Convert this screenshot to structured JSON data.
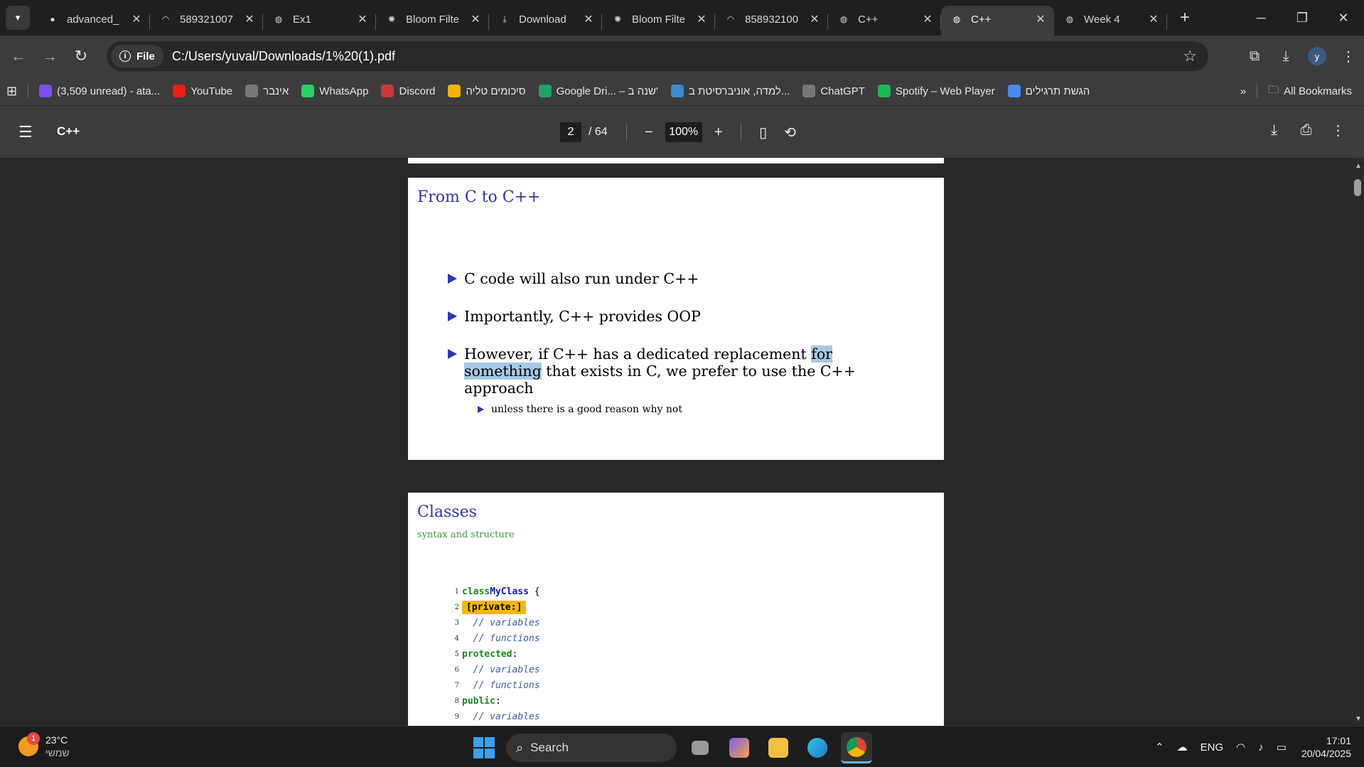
{
  "browser": {
    "tabs": [
      {
        "label": "advanced_",
        "icon": "github-icon",
        "active": false
      },
      {
        "label": "589321007",
        "icon": "moodle-icon",
        "active": false
      },
      {
        "label": "Ex1",
        "icon": "globe-icon",
        "active": false
      },
      {
        "label": "Bloom Filte",
        "icon": "chatgpt-icon",
        "active": false
      },
      {
        "label": "Download",
        "icon": "download-icon",
        "active": false
      },
      {
        "label": "Bloom Filte",
        "icon": "chatgpt-icon",
        "active": false
      },
      {
        "label": "858932100",
        "icon": "moodle-icon",
        "active": false
      },
      {
        "label": "C++",
        "icon": "globe-icon",
        "active": false
      },
      {
        "label": "C++",
        "icon": "globe-icon",
        "active": true
      },
      {
        "label": "Week 4",
        "icon": "globe-icon",
        "active": false
      }
    ],
    "address": {
      "chip_label": "File",
      "url": "C:/Users/yuval/Downloads/1%20(1).pdf"
    },
    "profile_initial": "y",
    "bookmarks": [
      {
        "label": "(3,509 unread) - ata...",
        "icon": "mail-icon",
        "color": "#7b4ff0"
      },
      {
        "label": "YouTube",
        "icon": "youtube-icon",
        "color": "#e62117"
      },
      {
        "label": "אינבר",
        "icon": "globe-icon",
        "color": "#777777"
      },
      {
        "label": "WhatsApp",
        "icon": "whatsapp-icon",
        "color": "#25d366"
      },
      {
        "label": "Discord",
        "icon": "discord-icon",
        "color": "#c93a3a"
      },
      {
        "label": "סיכומים טליה",
        "icon": "drive-icon",
        "color": "#f4b400"
      },
      {
        "label": "Google Dri... – שנה ב'",
        "icon": "drive-icon",
        "color": "#1fa463"
      },
      {
        "label": "למדה, אוניברסיטת ב...",
        "icon": "moodle-icon",
        "color": "#3b8bd0"
      },
      {
        "label": "ChatGPT",
        "icon": "chatgpt-icon",
        "color": "#777777"
      },
      {
        "label": "Spotify – Web Player",
        "icon": "spotify-icon",
        "color": "#1db954"
      },
      {
        "label": "הגשת תרגילים",
        "icon": "upload-icon",
        "color": "#4a8af4"
      }
    ],
    "all_bookmarks_label": "All Bookmarks"
  },
  "pdf": {
    "title": "C++",
    "current_page": "2",
    "total_pages": "/ 64",
    "zoom": "100%"
  },
  "slides": {
    "slide1": {
      "title": "From C to C++",
      "bullets": [
        {
          "text": "C code will also run under C++"
        },
        {
          "text": "Importantly, C++ provides OOP"
        },
        {
          "pre": "However, if C++ has a dedicated replacement ",
          "highlight": "for something",
          "post": " that exists in C, we prefer to use the C++ approach"
        }
      ],
      "subbullet": "unless there is a good reason why not"
    },
    "slide2": {
      "title": "Classes",
      "subtitle": "syntax and structure",
      "code": [
        {
          "n": "1",
          "kw": "class",
          "cls": "MyClass",
          "rest": " {"
        },
        {
          "n": "2",
          "priv": "[private:]"
        },
        {
          "n": "3",
          "cmt": "  // variables"
        },
        {
          "n": "4",
          "cmt": "  // functions"
        },
        {
          "n": "5",
          "kw": "protected",
          "rest": ":"
        },
        {
          "n": "6",
          "cmt": "  // variables"
        },
        {
          "n": "7",
          "cmt": "  // functions"
        },
        {
          "n": "8",
          "kw": "public",
          "rest": ":"
        },
        {
          "n": "9",
          "cmt": "  // variables"
        }
      ]
    }
  },
  "taskbar": {
    "notification_count": "1",
    "temperature": "23°C",
    "weather_text": "שמשי",
    "search_label": "Search",
    "language": "ENG",
    "time": "17:01",
    "date": "20/04/2025"
  }
}
